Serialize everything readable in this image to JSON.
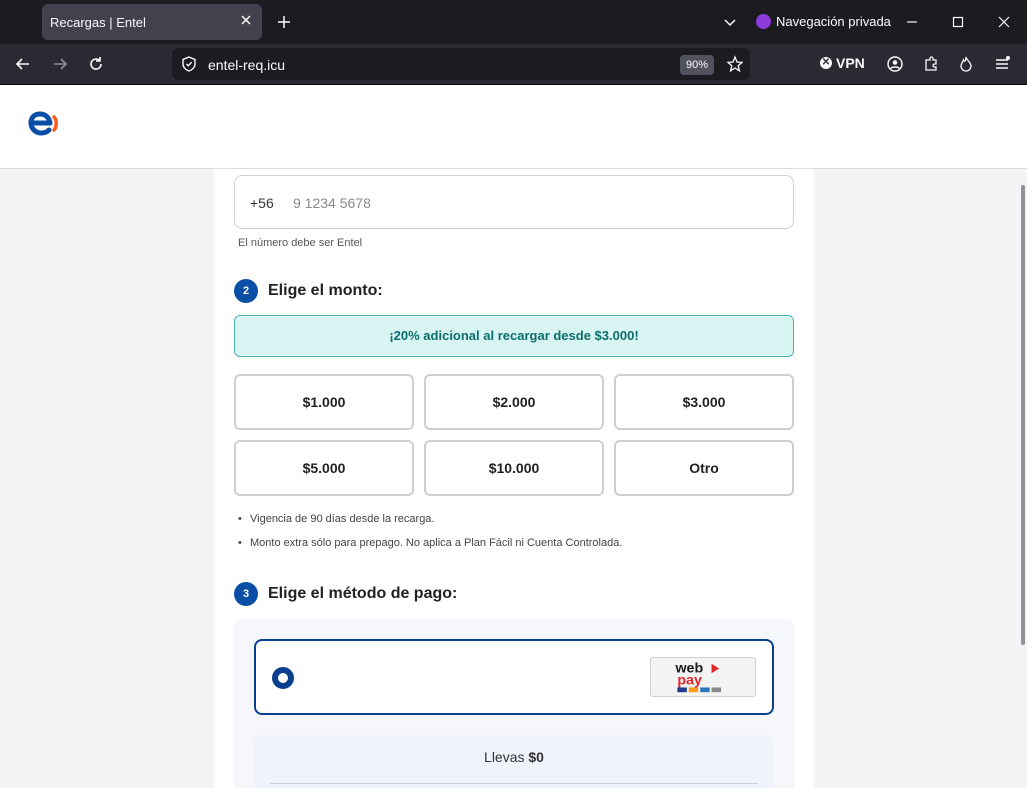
{
  "browser": {
    "tab_title": "Recargas | Entel",
    "private_label": "Navegación privada",
    "url": "entel-req.icu",
    "zoom": "90%",
    "vpn_label": "VPN"
  },
  "form": {
    "phone_prefix": "+56",
    "phone_placeholder": "9 1234 5678",
    "phone_hint": "El número debe ser Entel",
    "step2": {
      "num": "2",
      "label": "Elige el monto:"
    },
    "promo": "¡20% adicional al recargar desde $3.000!",
    "amounts": [
      "$1.000",
      "$2.000",
      "$3.000",
      "$5.000",
      "$10.000",
      "Otro"
    ],
    "notes": [
      "Vigencia de 90 días desde la recarga.",
      "Monto extra sólo para prepago. No aplica a Plan Fácil ni Cuenta Controlada."
    ],
    "step3": {
      "num": "3",
      "label": "Elige el método de pago:"
    },
    "payment_logo": "webpay plus",
    "summary_label": "Llevas",
    "summary_value": "$0"
  },
  "colors": {
    "brand_blue": "#0a4fa6",
    "brand_orange": "#ff5a1f",
    "promo_bg": "#d9f5f3",
    "promo_text": "#0b6e68"
  }
}
